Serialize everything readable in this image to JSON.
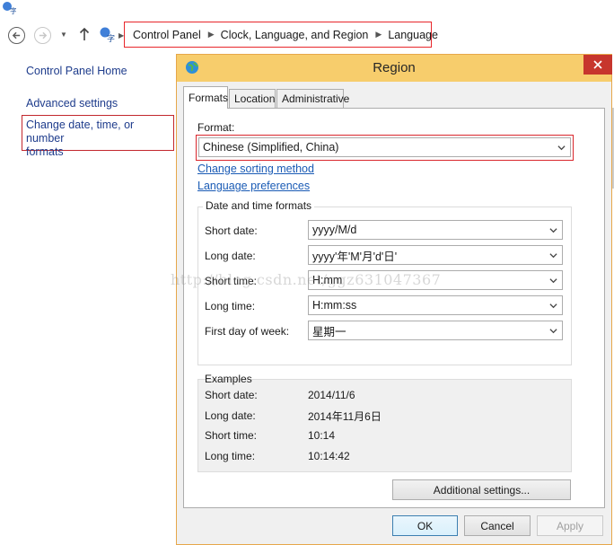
{
  "breadcrumb": [
    "Control Panel",
    "Clock, Language, and Region",
    "Language"
  ],
  "sidebar": {
    "home": "Control Panel Home",
    "advanced": "Advanced settings",
    "change_line1": "Change date, time, or number",
    "change_line2": "formats"
  },
  "dialog": {
    "title": "Region",
    "tabs": [
      "Formats",
      "Location",
      "Administrative"
    ],
    "format_label": "Format:",
    "format_value": "Chinese (Simplified, China)",
    "link_sorting": "Change sorting method",
    "link_language": "Language preferences",
    "datetime_group": "Date and time formats",
    "rows": [
      {
        "label": "Short date:",
        "value": "yyyy/M/d"
      },
      {
        "label": "Long date:",
        "value": "yyyy'年'M'月'd'日'"
      },
      {
        "label": "Short time:",
        "value": "H:mm"
      },
      {
        "label": "Long time:",
        "value": "H:mm:ss"
      },
      {
        "label": "First day of week:",
        "value": "星期一"
      }
    ],
    "examples_group": "Examples",
    "examples": [
      {
        "label": "Short date:",
        "value": "2014/11/6"
      },
      {
        "label": "Long date:",
        "value": "2014年11月6日"
      },
      {
        "label": "Short time:",
        "value": "10:14"
      },
      {
        "label": "Long time:",
        "value": "10:14:42"
      }
    ],
    "additional_button": "Additional settings...",
    "ok_button": "OK",
    "cancel_button": "Cancel",
    "apply_button": "Apply"
  },
  "watermark": "http://blog.csdn.net/ggz631047367",
  "colors": {
    "highlight_border": "#e8262b",
    "dialog_title": "#f7cd6c",
    "close_button": "#c7362d",
    "link": "#1a5bb5"
  }
}
